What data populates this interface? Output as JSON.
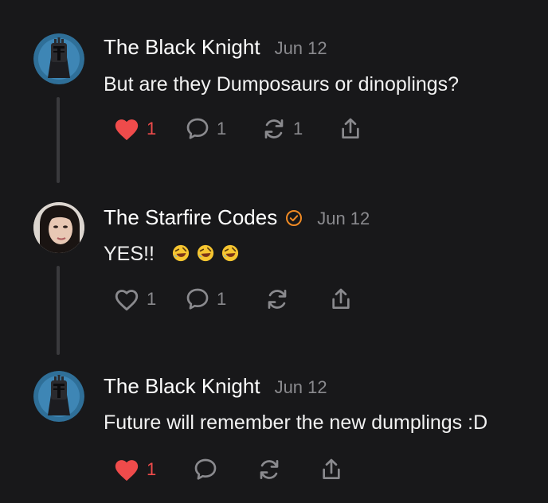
{
  "posts": [
    {
      "author": "The Black Knight",
      "date": "Jun 12",
      "text": "But are they Dumposaurs or dinoplings?",
      "avatar_icon": "knight-avatar",
      "liked": true,
      "likes": "1",
      "replies": "1",
      "reposts": "1"
    },
    {
      "author": "The Starfire Codes",
      "date": "Jun 12",
      "verified": true,
      "text": "YES!!",
      "emoji": [
        "rolling-laughing-emoji",
        "rolling-laughing-emoji",
        "rolling-laughing-emoji"
      ],
      "avatar_icon": "woman-portrait-avatar",
      "liked": false,
      "likes": "1",
      "replies": "1",
      "reposts": ""
    },
    {
      "author": "The Black Knight",
      "date": "Jun 12",
      "text": "Future will remember the new dumplings :D",
      "avatar_icon": "knight-avatar",
      "liked": true,
      "likes": "1",
      "replies": "",
      "reposts": ""
    }
  ],
  "colors": {
    "background": "#18181a",
    "like_active": "#ef4b4b",
    "muted": "#8a8a8e",
    "verified": "#f08a24"
  }
}
